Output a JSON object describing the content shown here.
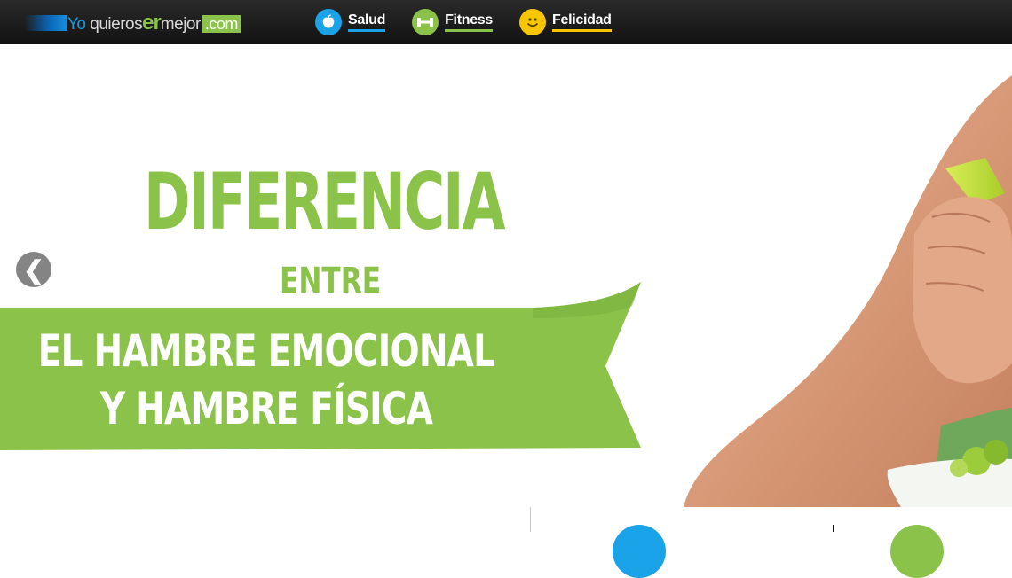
{
  "site": {
    "logo": {
      "part_yo": "Yo",
      "part_quiero": " quiero",
      "part_s": "s",
      "part_er": "er",
      "part_mejor": "mejor",
      "part_com": ".com"
    }
  },
  "nav": [
    {
      "label": "Salud",
      "icon": "apple-icon",
      "color": "#1aa3e8"
    },
    {
      "label": "Fitness",
      "icon": "dumbbell-icon",
      "color": "#8bc34a"
    },
    {
      "label": "Felicidad",
      "icon": "smiley-icon",
      "color": "#f7c600"
    }
  ],
  "hero": {
    "title": "DIFERENCIA",
    "connector": "ENTRE",
    "banner_line1": "EL HAMBRE EMOCIONAL",
    "banner_line2": "Y HAMBRE FÍSICA",
    "accent_color": "#8bc34a",
    "prev_arrow": "❮"
  }
}
